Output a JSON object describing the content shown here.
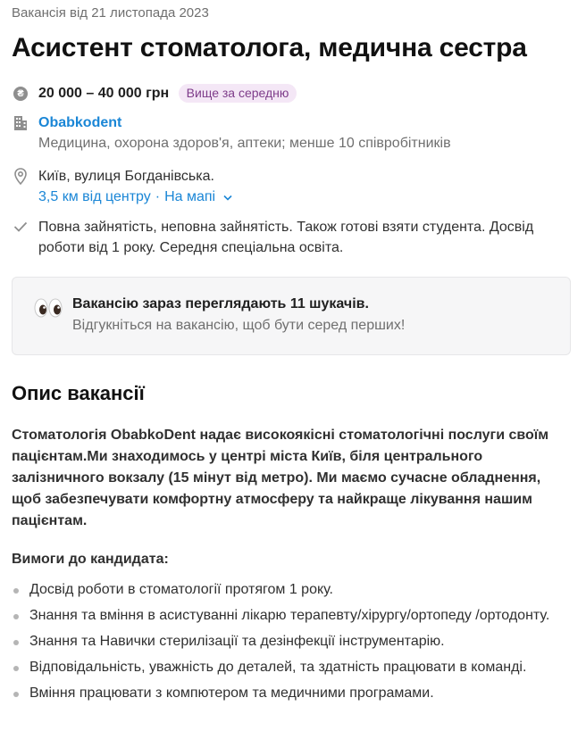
{
  "header": {
    "posted": "Вакансія від 21 листопада 2023",
    "title": "Асистент стоматолога, медична сестра"
  },
  "salary": {
    "icon": "hryvnia-coin-icon",
    "coin_glyph": "₴",
    "amount": "20 000 – 40 000 грн",
    "badge": "Вище за середню"
  },
  "company": {
    "icon": "building-icon",
    "name": "Obabkodent",
    "description": "Медицина, охорона здоров'я, аптеки; менше 10 співробітників"
  },
  "location": {
    "icon": "map-pin-icon",
    "address": "Київ, вулиця Богданівська.",
    "distance": "3,5 км від центру",
    "separator": "·",
    "map_link": "На мапі"
  },
  "terms": {
    "icon": "checkmark-icon",
    "text": "Повна зайнятість, неповна зайнятість. Також готові взяти студента. Досвід роботи від 1 року. Середня спеціальна освіта."
  },
  "notice": {
    "icon": "eyes-icon",
    "title": "Вакансію зараз переглядають 11 шукачів.",
    "subtitle": "Відгукніться на вакансію, щоб бути серед перших!"
  },
  "description": {
    "heading": "Опис вакансії",
    "lead": "Стоматологія ObabkoDent надає високоякісні стоматологічні послуги своїм пацієнтам.Ми знаходимось у центрі міста Київ, біля центрального залізничного вокзалу (15 мінут від метро). Ми маємо сучасне обладнення, щоб забезпечувати комфортну атмосферу та найкраще лікування нашим пацієнтам.",
    "requirements_heading": "Вимоги до кандидата:",
    "requirements": [
      "Досвід роботи в стоматології протягом 1 року.",
      "Знання та вміння в асистуванні лікарю терапевту/хірургу/ортопеду /ортодонту.",
      "Знання та Навички стерилізації та дезінфекції інструментарію.",
      "Відповідальність, уважність до деталей, та здатність працювати в команді.",
      "Вміння працювати з компютером та медичними програмами."
    ]
  }
}
